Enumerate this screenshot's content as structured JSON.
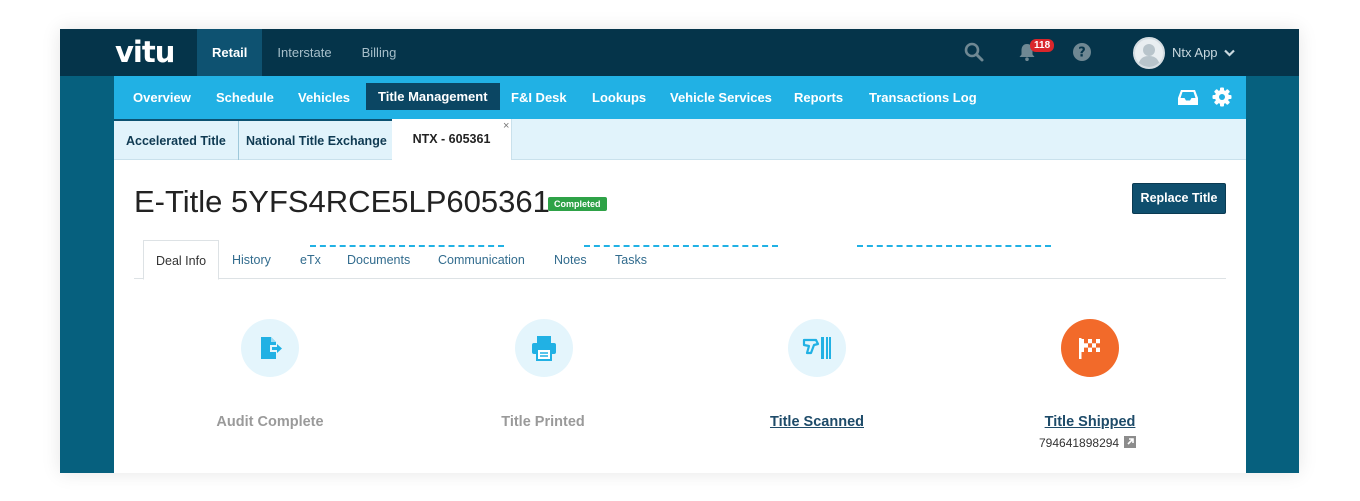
{
  "brand": {
    "logo": "vitu"
  },
  "top_nav": [
    {
      "label": "Retail",
      "active": true
    },
    {
      "label": "Interstate",
      "active": false
    },
    {
      "label": "Billing",
      "active": false
    }
  ],
  "top_icons": {
    "search": "search-icon",
    "bell": "bell-icon",
    "help": "help-icon"
  },
  "notifications": {
    "count": "118"
  },
  "user": {
    "name": "Ntx App",
    "menu_icon": "chevron-down-icon"
  },
  "sub_nav": [
    {
      "label": "Overview"
    },
    {
      "label": "Schedule"
    },
    {
      "label": "Vehicles"
    },
    {
      "label": "Title Management",
      "active": true
    },
    {
      "label": "F&I Desk"
    },
    {
      "label": "Lookups"
    },
    {
      "label": "Vehicle Services"
    },
    {
      "label": "Reports"
    },
    {
      "label": "Transactions Log"
    }
  ],
  "sub_nav_icons": {
    "inbox": "inbox-icon",
    "settings": "gear-icon"
  },
  "doc_tabs": [
    {
      "label": "Accelerated Title"
    },
    {
      "label": "National Title Exchange"
    },
    {
      "label": "NTX - 605361",
      "active": true,
      "close": "×"
    }
  ],
  "page": {
    "title": "E-Title 5YFS4RCE5LP605361",
    "status": "Completed",
    "replace_button": "Replace Title"
  },
  "page_tabs": [
    {
      "label": "Deal Info",
      "active": true
    },
    {
      "label": "History"
    },
    {
      "label": "eTx"
    },
    {
      "label": "Documents"
    },
    {
      "label": "Communication"
    },
    {
      "label": "Notes"
    },
    {
      "label": "Tasks"
    }
  ],
  "steps": [
    {
      "label": "Audit Complete",
      "icon": "document-export-icon",
      "link": false
    },
    {
      "label": "Title Printed",
      "icon": "printer-icon",
      "link": false
    },
    {
      "label": "Title Scanned",
      "icon": "scanner-icon",
      "link": true
    },
    {
      "label": "Title Shipped",
      "icon": "checkered-flag-icon",
      "link": true,
      "tracking": "794641898294",
      "tracking_icon": "external-link-icon"
    }
  ],
  "colors": {
    "frame": "#06607e",
    "topbar": "#05344a",
    "subnav": "#21b1e4",
    "accent_dark": "#0f4f6e",
    "success": "#2ea247",
    "final_step": "#f26a2a",
    "badge": "#d9262b"
  }
}
